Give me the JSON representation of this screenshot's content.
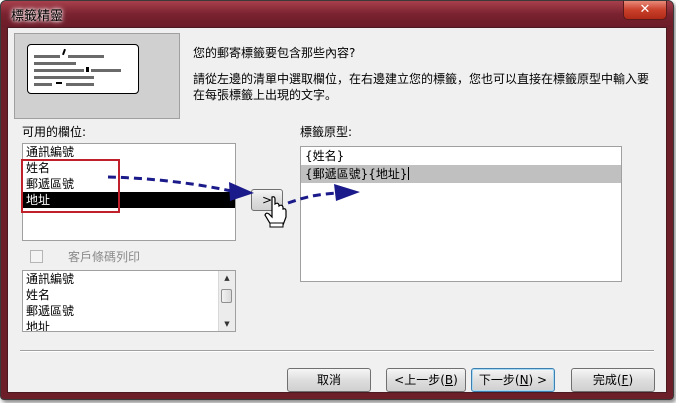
{
  "window": {
    "title": "標籤精靈",
    "close_glyph": "✕"
  },
  "instructions": {
    "question": "您的郵寄標籤要包含那些內容?",
    "line1": "請從左邊的清單中選取欄位，在右邊建立您的標籤，您也可以直接在標籤原型中輸入要",
    "line2": "在每張標籤上出現的文字。"
  },
  "available_fields": {
    "label": "可用的欄位:",
    "items": [
      "通訊編號",
      "姓名",
      "郵遞區號",
      "地址"
    ],
    "selected": "地址"
  },
  "move_button": {
    "label": ">"
  },
  "prototype": {
    "label": "標籤原型:",
    "lines": [
      "{姓名}",
      "{郵遞區號}{地址}"
    ]
  },
  "barcode": {
    "label": "客戶條碼列印",
    "checked": false,
    "items": [
      "通訊編號",
      "姓名",
      "郵遞區號",
      "地址"
    ]
  },
  "buttons": {
    "cancel": "取消",
    "back_text": "<上一步(",
    "back_key": "B",
    "back_end": ")",
    "next_text": "下一步(",
    "next_key": "N",
    "next_end": ") >",
    "finish_text": "完成(",
    "finish_key": "F",
    "finish_end": ")"
  },
  "colors": {
    "titlebar": "#7a2230",
    "selection": "#000000",
    "prototype_highlight": "#c0c0c0",
    "annotation_box": "#c0202a",
    "annotation_arrow": "#1a1a8a"
  }
}
